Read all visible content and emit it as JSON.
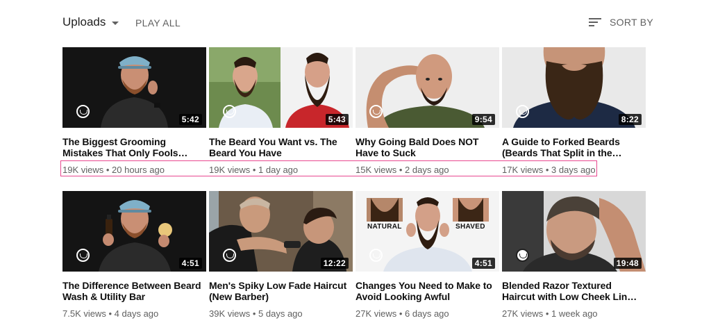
{
  "header": {
    "uploads_label": "Uploads",
    "play_all_label": "PLAY ALL",
    "sort_label": "SORT BY"
  },
  "videos": [
    {
      "title": "The Biggest Grooming Mistakes That Only Fools…",
      "views": "19K views",
      "age": "20 hours ago",
      "duration": "5:42"
    },
    {
      "title": "The Beard You Want vs. The Beard You Have",
      "views": "19K views",
      "age": "1 day ago",
      "duration": "5:43"
    },
    {
      "title": "Why Going Bald Does NOT Have to Suck",
      "views": "15K views",
      "age": "2 days ago",
      "duration": "9:54"
    },
    {
      "title": "A Guide to Forked Beards (Beards That Split in the…",
      "views": "17K views",
      "age": "3 days ago",
      "duration": "8:22"
    },
    {
      "title": "The Difference Between Beard Wash & Utility Bar",
      "views": "7.5K views",
      "age": "4 days ago",
      "duration": "4:51"
    },
    {
      "title": "Men's Spiky Low Fade Haircut (New Barber)",
      "views": "39K views",
      "age": "5 days ago",
      "duration": "12:22"
    },
    {
      "title": "Changes You Need to Make to Avoid Looking Awful",
      "views": "27K views",
      "age": "6 days ago",
      "duration": "4:51",
      "thumb_labels": [
        "NATURAL",
        "SHAVED"
      ]
    },
    {
      "title": "Blended Razor Textured Haircut with Low Cheek Lin…",
      "views": "27K views",
      "age": "1 week ago",
      "duration": "19:48"
    }
  ],
  "meta_separator": " • ",
  "colors": {
    "highlight": "#e8478f",
    "meta_text": "#606060"
  }
}
